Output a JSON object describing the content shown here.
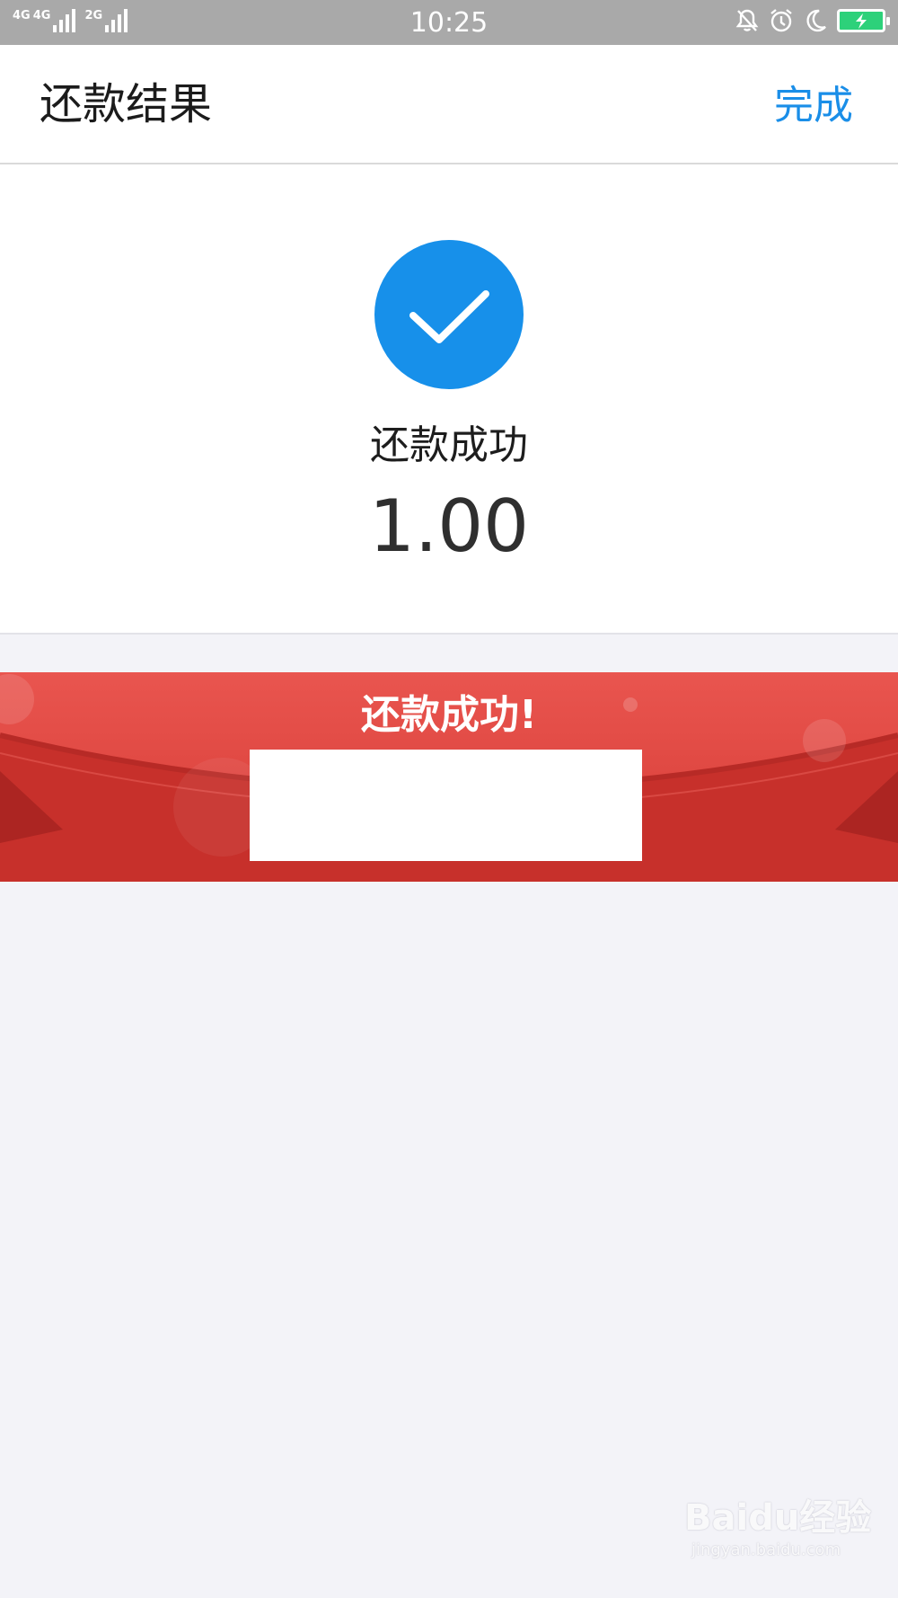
{
  "status_bar": {
    "network_1": "4G",
    "network_2": "4G",
    "network_3": "2G",
    "time": "10:25",
    "icons": [
      "bell-off-icon",
      "alarm-icon",
      "moon-icon",
      "battery-charging-icon"
    ]
  },
  "header": {
    "title": "还款结果",
    "done_label": "完成"
  },
  "result": {
    "status_text": "还款成功",
    "amount": "1.00",
    "icon": "check-circle-icon"
  },
  "banner": {
    "title": "还款成功!"
  },
  "watermark": {
    "line1": "Baidu经验",
    "line2": "jingyan.baidu.com"
  },
  "colors": {
    "accent_blue": "#1790ea",
    "link_blue": "#1a8ee8",
    "banner_red": "#d63b35",
    "status_bar_gray": "#a9a9a9",
    "page_bg": "#f3f3f8"
  }
}
